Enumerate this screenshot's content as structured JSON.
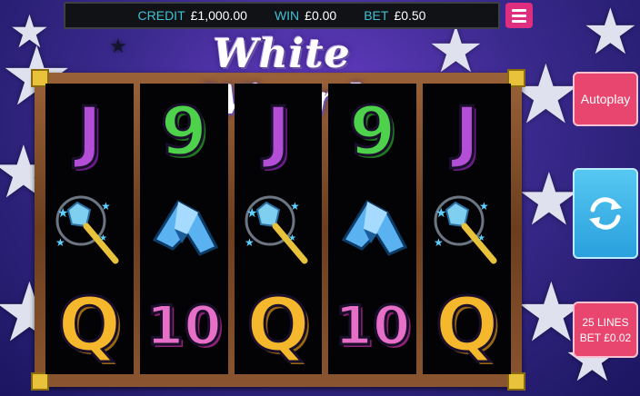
{
  "status_bar": {
    "credit_label": "CREDIT",
    "credit_value": "£1,000.00",
    "win_label": "WIN",
    "win_value": "£0.00",
    "bet_label": "BET",
    "bet_value": "£0.50"
  },
  "game_title": "White Wizard",
  "reels": [
    {
      "symbols": [
        "J",
        "wand",
        "Q"
      ]
    },
    {
      "symbols": [
        "9",
        "A",
        "10"
      ]
    },
    {
      "symbols": [
        "J",
        "wand",
        "Q"
      ]
    },
    {
      "symbols": [
        "9",
        "A",
        "10"
      ]
    },
    {
      "symbols": [
        "J",
        "wand",
        "Q"
      ]
    }
  ],
  "controls": {
    "autoplay_label": "Autoplay",
    "spin_icon": "refresh-icon",
    "lines_label": "25 LINES",
    "line_bet_label": "BET £0.02",
    "menu_icon": "hamburger-menu-icon"
  },
  "colors": {
    "accent_pink": "#e8456f",
    "spin_blue": "#2aa0dd",
    "label_cyan": "#3fc1d6"
  }
}
